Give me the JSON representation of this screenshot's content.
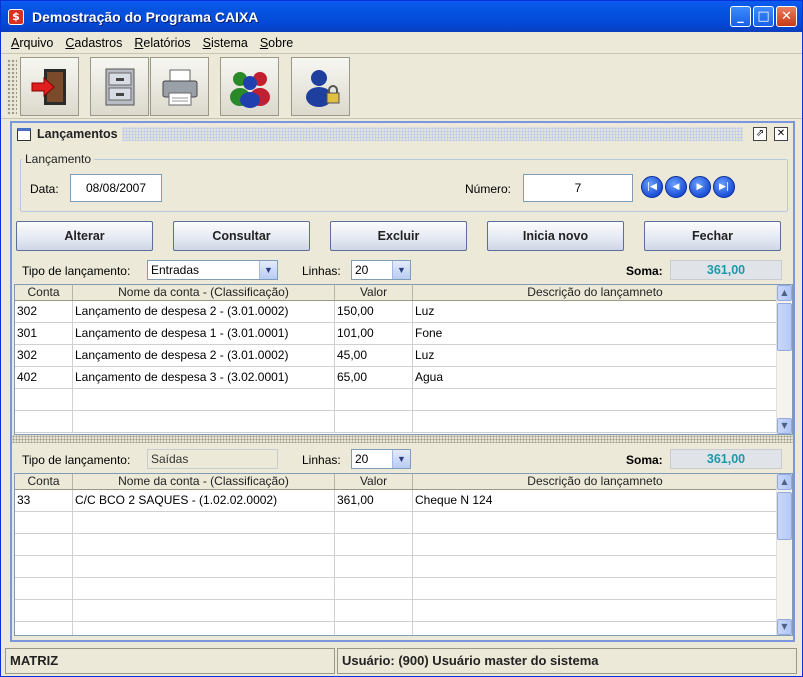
{
  "window": {
    "title": "Demostração do Programa CAIXA",
    "minimize": "_",
    "maximize": "□",
    "close": "✕"
  },
  "menu": [
    "Arquivo",
    "Cadastros",
    "Relatórios",
    "Sistema",
    "Sobre"
  ],
  "toolbar": [
    "exit-door-icon",
    "file-cabinet-icon",
    "printer-icon",
    "users-icon",
    "user-lock-icon"
  ],
  "frame": {
    "title": "Lançamentos"
  },
  "lancamento": {
    "group_label": "Lançamento",
    "data_label": "Data:",
    "data_value": "08/08/2007",
    "numero_label": "Número:",
    "numero_value": "7"
  },
  "buttons": {
    "alterar": "Alterar",
    "consultar": "Consultar",
    "excluir": "Excluir",
    "inicia_novo": "Inicia novo",
    "fechar": "Fechar"
  },
  "entradas": {
    "tipo_label": "Tipo de lançamento:",
    "tipo_value": "Entradas",
    "linhas_label": "Linhas:",
    "linhas_value": "20",
    "soma_label": "Soma:",
    "soma_value": "361,00",
    "columns": [
      "Conta",
      "Nome da conta - (Classificação)",
      "Valor",
      "Descrição do lançamneto"
    ],
    "rows": [
      [
        "302",
        "Lançamento de despesa 2 - (3.01.0002)",
        "150,00",
        "Luz"
      ],
      [
        "301",
        "Lançamento de despesa 1 - (3.01.0001)",
        "101,00",
        "Fone"
      ],
      [
        "302",
        "Lançamento de despesa 2 - (3.01.0002)",
        "45,00",
        "Luz"
      ],
      [
        "402",
        "Lançamento de despesa 3 - (3.02.0001)",
        "65,00",
        "Agua"
      ],
      [
        "",
        "",
        "",
        ""
      ],
      [
        "",
        "",
        "",
        ""
      ]
    ]
  },
  "saidas": {
    "tipo_label": "Tipo de lançamento:",
    "tipo_value": "Saídas",
    "linhas_label": "Linhas:",
    "linhas_value": "20",
    "soma_label": "Soma:",
    "soma_value": "361,00",
    "columns": [
      "Conta",
      "Nome da conta - (Classificação)",
      "Valor",
      "Descrição do lançamneto"
    ],
    "rows": [
      [
        "33",
        "C/C BCO 2 SAQUES - (1.02.02.0002)",
        "361,00",
        "Cheque N 124"
      ],
      [
        "",
        "",
        "",
        ""
      ],
      [
        "",
        "",
        "",
        ""
      ],
      [
        "",
        "",
        "",
        ""
      ],
      [
        "",
        "",
        "",
        ""
      ],
      [
        "",
        "",
        "",
        ""
      ],
      [
        "",
        "",
        "",
        ""
      ]
    ]
  },
  "status": {
    "left": "MATRIZ",
    "right": "Usuário: (900) Usuário master do sistema"
  }
}
